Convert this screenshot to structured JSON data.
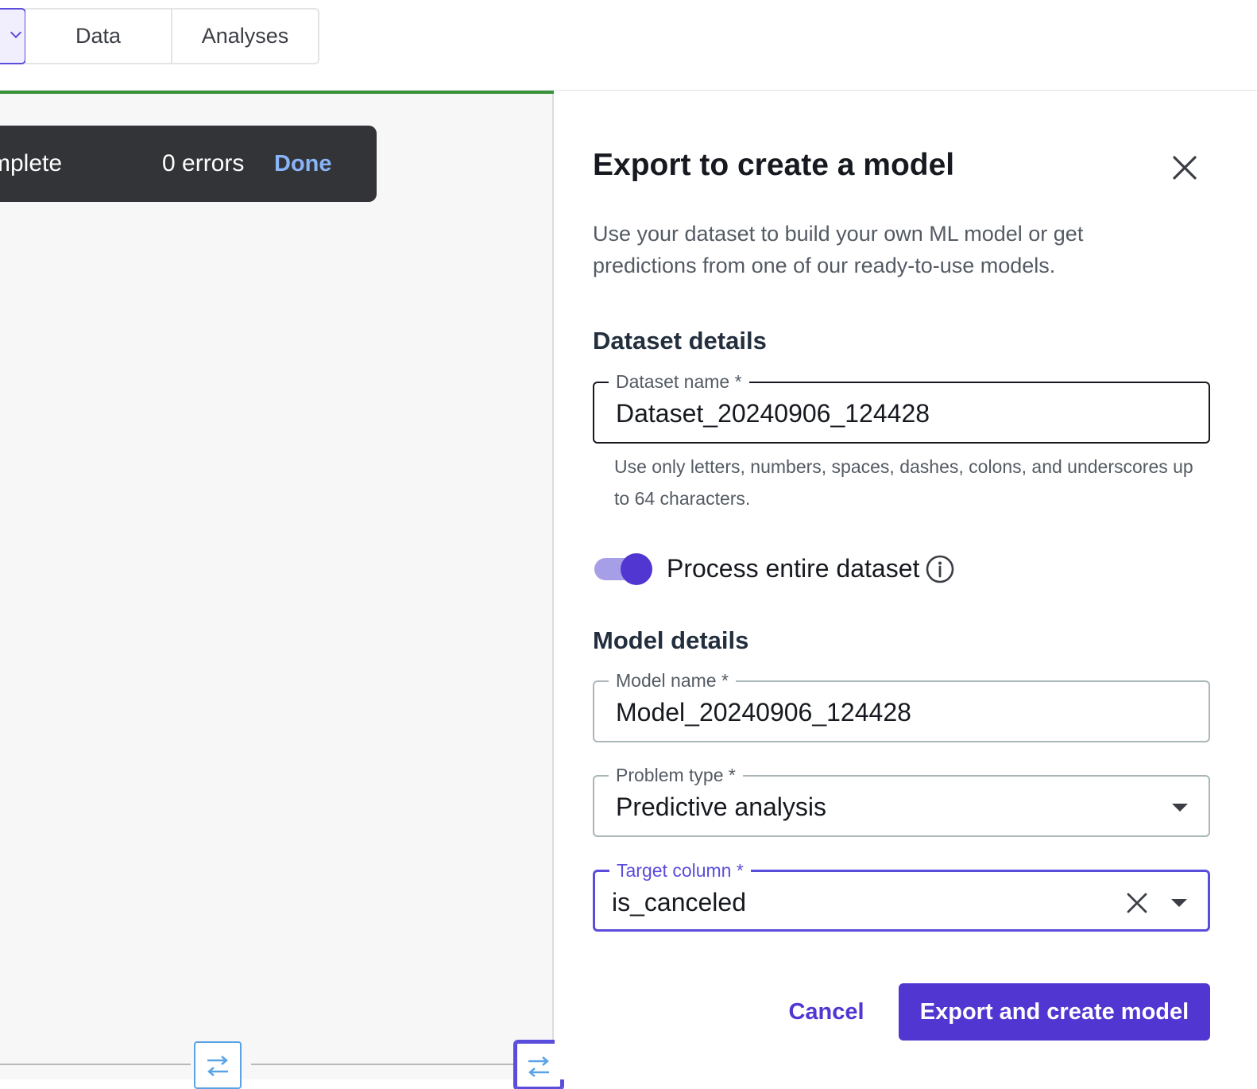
{
  "tabs": [
    {
      "label": "Data"
    },
    {
      "label": "Analyses"
    }
  ],
  "toast": {
    "status_text": "mplete",
    "errors_text": "0 errors",
    "done_label": "Done"
  },
  "panel": {
    "title": "Export to create a model",
    "description": "Use your dataset to build your own ML model or get predictions from one of our ready-to-use models.",
    "dataset_section": {
      "title": "Dataset details",
      "dataset_name": {
        "label": "Dataset name *",
        "value": "Dataset_20240906_124428",
        "helper": "Use only letters, numbers, spaces, dashes, colons, and underscores up to 64 characters."
      },
      "process_entire": {
        "label": "Process entire dataset",
        "enabled": true
      }
    },
    "model_section": {
      "title": "Model details",
      "model_name": {
        "label": "Model name *",
        "value": "Model_20240906_124428"
      },
      "problem_type": {
        "label": "Problem type *",
        "value": "Predictive analysis"
      },
      "target_column": {
        "label": "Target column *",
        "value": "is_canceled"
      }
    },
    "actions": {
      "cancel_label": "Cancel",
      "primary_label": "Export and create model"
    }
  },
  "colors": {
    "accent": "#5136d1",
    "progress": "#37923a",
    "toast_bg": "#333437",
    "toast_link": "#8ab4f8"
  }
}
